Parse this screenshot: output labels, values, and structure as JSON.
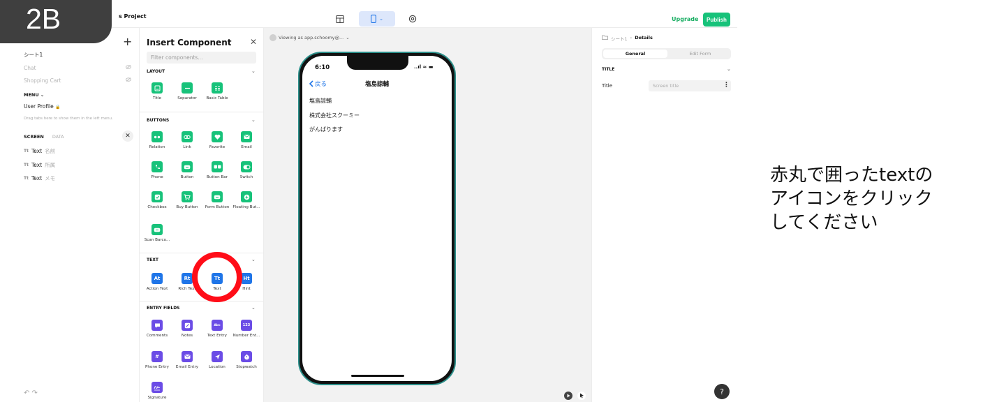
{
  "badge": {
    "label": "2B"
  },
  "topbar": {
    "project_title": "s Project",
    "upgrade_label": "Upgrade",
    "publish_label": "Publish",
    "device_chevron": "⌄"
  },
  "left": {
    "plus": "+",
    "tabs": [
      {
        "label": "シート1"
      },
      {
        "label": "Chat"
      },
      {
        "label": "Shopping Cart"
      }
    ],
    "menu_label": "MENU",
    "menu_chevron": "⌄",
    "user_profile": "User Profile",
    "drag_hint": "Drag tabs here to show them in the left menu.",
    "screen_tab": "SCREEN",
    "data_tab": "DATA",
    "close": "✕",
    "components": [
      {
        "type": "Tt",
        "name": "Text",
        "value": "名前"
      },
      {
        "type": "Tt",
        "name": "Text",
        "value": "所属"
      },
      {
        "type": "Tt",
        "name": "Text",
        "value": "メモ"
      }
    ],
    "undo_redo": "↶  ↷"
  },
  "panel": {
    "title": "Insert Component",
    "close": "✕",
    "filter_placeholder": "Filter components...",
    "chevron": "⌄",
    "sections": {
      "layout": {
        "header": "LAYOUT",
        "items": [
          "Title",
          "Separator",
          "Basic Table"
        ]
      },
      "buttons": {
        "header": "BUTTONS",
        "items": [
          "Relation",
          "Link",
          "Favorite",
          "Email",
          "Phone",
          "Button",
          "Button Bar",
          "Switch",
          "Checkbox",
          "Buy Button",
          "Form Button",
          "Floating But...",
          "Scan Barco..."
        ]
      },
      "text": {
        "header": "TEXT",
        "items": [
          "Action Text",
          "Rich Text",
          "Text",
          "Hint"
        ],
        "glyphs": [
          "At",
          "Rt",
          "Tt",
          "Ht"
        ]
      },
      "entry": {
        "header": "ENTRY FIELDS",
        "items": [
          "Comments",
          "Notes",
          "Text Entry",
          "Number Ent...",
          "Phone Entry",
          "Email Entry",
          "Location",
          "Stopwatch",
          "Signature"
        ],
        "glyphs": [
          "Abc",
          "123",
          "#"
        ]
      }
    }
  },
  "canvas": {
    "viewing_as": "Viewing as app.schoomy@...",
    "viewing_chevron": "⌄",
    "phone": {
      "time": "6:10",
      "status": "..ıl ≈ ▬",
      "back_label": "戻る",
      "nav_title": "塩島諒輔",
      "rows": [
        "塩島諒輔",
        "株式会社スクーミー",
        "がんばります"
      ]
    }
  },
  "right": {
    "breadcrumb_parent": "シート1",
    "breadcrumb_sep": "›",
    "breadcrumb_current": "Details",
    "tab_general": "General",
    "tab_edit_form": "Edit Form",
    "section_title": "TITLE",
    "chevron": "⌄",
    "field_label": "Title",
    "field_placeholder": "Screen title",
    "dots": "⋮",
    "help": "?"
  },
  "annotation": {
    "lines": [
      "赤丸で囲ったtextの",
      "アイコンをクリック",
      "してください"
    ]
  },
  "colors": {
    "green": "#17c27a",
    "blue": "#1f75e8",
    "purple": "#6b4ce6",
    "annotation_red": "#ff0d18"
  }
}
